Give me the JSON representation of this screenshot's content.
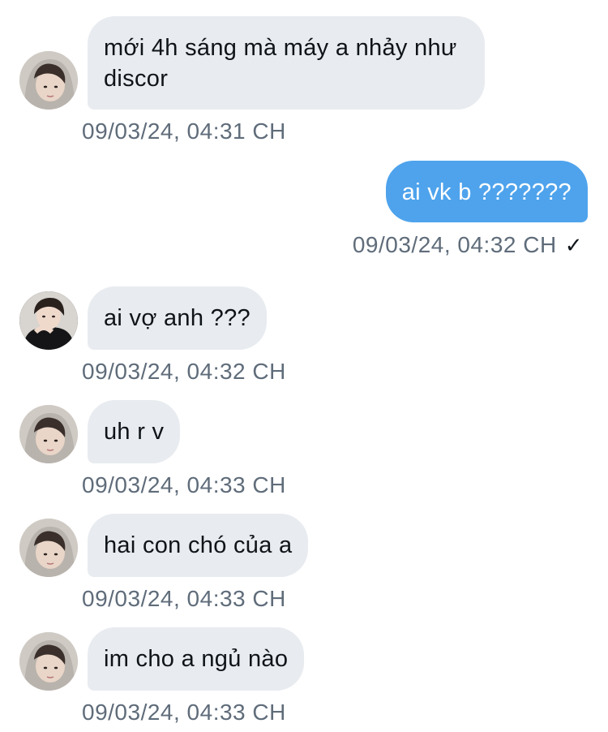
{
  "messages": [
    {
      "direction": "in",
      "text": "mới 4h sáng mà máy a nhảy như discor",
      "time": "09/03/24, 04:31 CH",
      "avatar": "avatar-hooded"
    },
    {
      "direction": "out",
      "text": "ai vk b ???????",
      "time": "09/03/24, 04:32 CH",
      "status_icon": "check-icon",
      "status_glyph": "✓"
    },
    {
      "direction": "in",
      "text": "ai vợ anh ???",
      "time": "09/03/24, 04:32 CH",
      "avatar": "avatar-dark"
    },
    {
      "direction": "in",
      "text": "uh r v",
      "time": "09/03/24, 04:33 CH",
      "avatar": "avatar-hooded"
    },
    {
      "direction": "in",
      "text": "hai con chó của a",
      "time": "09/03/24, 04:33 CH",
      "avatar": "avatar-hooded"
    },
    {
      "direction": "in",
      "text": "im cho a ngủ nào",
      "time": "09/03/24, 04:33 CH",
      "avatar": "avatar-hooded"
    }
  ],
  "colors": {
    "incoming_bubble": "#e8ebef",
    "outgoing_bubble": "#4ea3ec",
    "timestamp": "#5f6c7a",
    "text": "#0f1419"
  }
}
